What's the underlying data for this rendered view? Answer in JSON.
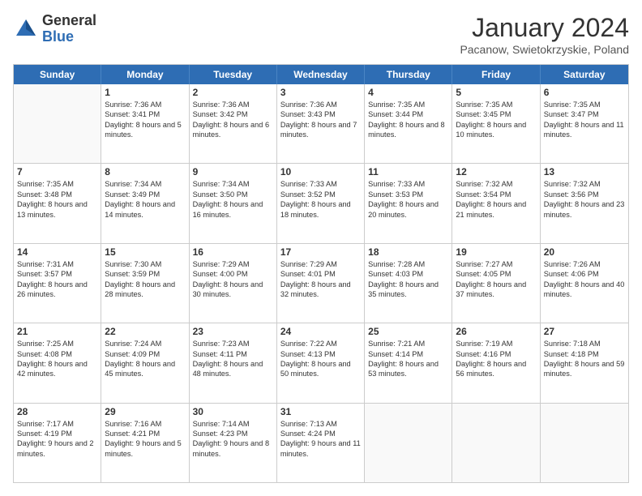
{
  "header": {
    "logo_general": "General",
    "logo_blue": "Blue",
    "month_title": "January 2024",
    "subtitle": "Pacanow, Swietokrzyskie, Poland"
  },
  "days_of_week": [
    "Sunday",
    "Monday",
    "Tuesday",
    "Wednesday",
    "Thursday",
    "Friday",
    "Saturday"
  ],
  "weeks": [
    [
      {
        "day": "",
        "sunrise": "",
        "sunset": "",
        "daylight": ""
      },
      {
        "day": "1",
        "sunrise": "Sunrise: 7:36 AM",
        "sunset": "Sunset: 3:41 PM",
        "daylight": "Daylight: 8 hours and 5 minutes."
      },
      {
        "day": "2",
        "sunrise": "Sunrise: 7:36 AM",
        "sunset": "Sunset: 3:42 PM",
        "daylight": "Daylight: 8 hours and 6 minutes."
      },
      {
        "day": "3",
        "sunrise": "Sunrise: 7:36 AM",
        "sunset": "Sunset: 3:43 PM",
        "daylight": "Daylight: 8 hours and 7 minutes."
      },
      {
        "day": "4",
        "sunrise": "Sunrise: 7:35 AM",
        "sunset": "Sunset: 3:44 PM",
        "daylight": "Daylight: 8 hours and 8 minutes."
      },
      {
        "day": "5",
        "sunrise": "Sunrise: 7:35 AM",
        "sunset": "Sunset: 3:45 PM",
        "daylight": "Daylight: 8 hours and 10 minutes."
      },
      {
        "day": "6",
        "sunrise": "Sunrise: 7:35 AM",
        "sunset": "Sunset: 3:47 PM",
        "daylight": "Daylight: 8 hours and 11 minutes."
      }
    ],
    [
      {
        "day": "7",
        "sunrise": "Sunrise: 7:35 AM",
        "sunset": "Sunset: 3:48 PM",
        "daylight": "Daylight: 8 hours and 13 minutes."
      },
      {
        "day": "8",
        "sunrise": "Sunrise: 7:34 AM",
        "sunset": "Sunset: 3:49 PM",
        "daylight": "Daylight: 8 hours and 14 minutes."
      },
      {
        "day": "9",
        "sunrise": "Sunrise: 7:34 AM",
        "sunset": "Sunset: 3:50 PM",
        "daylight": "Daylight: 8 hours and 16 minutes."
      },
      {
        "day": "10",
        "sunrise": "Sunrise: 7:33 AM",
        "sunset": "Sunset: 3:52 PM",
        "daylight": "Daylight: 8 hours and 18 minutes."
      },
      {
        "day": "11",
        "sunrise": "Sunrise: 7:33 AM",
        "sunset": "Sunset: 3:53 PM",
        "daylight": "Daylight: 8 hours and 20 minutes."
      },
      {
        "day": "12",
        "sunrise": "Sunrise: 7:32 AM",
        "sunset": "Sunset: 3:54 PM",
        "daylight": "Daylight: 8 hours and 21 minutes."
      },
      {
        "day": "13",
        "sunrise": "Sunrise: 7:32 AM",
        "sunset": "Sunset: 3:56 PM",
        "daylight": "Daylight: 8 hours and 23 minutes."
      }
    ],
    [
      {
        "day": "14",
        "sunrise": "Sunrise: 7:31 AM",
        "sunset": "Sunset: 3:57 PM",
        "daylight": "Daylight: 8 hours and 26 minutes."
      },
      {
        "day": "15",
        "sunrise": "Sunrise: 7:30 AM",
        "sunset": "Sunset: 3:59 PM",
        "daylight": "Daylight: 8 hours and 28 minutes."
      },
      {
        "day": "16",
        "sunrise": "Sunrise: 7:29 AM",
        "sunset": "Sunset: 4:00 PM",
        "daylight": "Daylight: 8 hours and 30 minutes."
      },
      {
        "day": "17",
        "sunrise": "Sunrise: 7:29 AM",
        "sunset": "Sunset: 4:01 PM",
        "daylight": "Daylight: 8 hours and 32 minutes."
      },
      {
        "day": "18",
        "sunrise": "Sunrise: 7:28 AM",
        "sunset": "Sunset: 4:03 PM",
        "daylight": "Daylight: 8 hours and 35 minutes."
      },
      {
        "day": "19",
        "sunrise": "Sunrise: 7:27 AM",
        "sunset": "Sunset: 4:05 PM",
        "daylight": "Daylight: 8 hours and 37 minutes."
      },
      {
        "day": "20",
        "sunrise": "Sunrise: 7:26 AM",
        "sunset": "Sunset: 4:06 PM",
        "daylight": "Daylight: 8 hours and 40 minutes."
      }
    ],
    [
      {
        "day": "21",
        "sunrise": "Sunrise: 7:25 AM",
        "sunset": "Sunset: 4:08 PM",
        "daylight": "Daylight: 8 hours and 42 minutes."
      },
      {
        "day": "22",
        "sunrise": "Sunrise: 7:24 AM",
        "sunset": "Sunset: 4:09 PM",
        "daylight": "Daylight: 8 hours and 45 minutes."
      },
      {
        "day": "23",
        "sunrise": "Sunrise: 7:23 AM",
        "sunset": "Sunset: 4:11 PM",
        "daylight": "Daylight: 8 hours and 48 minutes."
      },
      {
        "day": "24",
        "sunrise": "Sunrise: 7:22 AM",
        "sunset": "Sunset: 4:13 PM",
        "daylight": "Daylight: 8 hours and 50 minutes."
      },
      {
        "day": "25",
        "sunrise": "Sunrise: 7:21 AM",
        "sunset": "Sunset: 4:14 PM",
        "daylight": "Daylight: 8 hours and 53 minutes."
      },
      {
        "day": "26",
        "sunrise": "Sunrise: 7:19 AM",
        "sunset": "Sunset: 4:16 PM",
        "daylight": "Daylight: 8 hours and 56 minutes."
      },
      {
        "day": "27",
        "sunrise": "Sunrise: 7:18 AM",
        "sunset": "Sunset: 4:18 PM",
        "daylight": "Daylight: 8 hours and 59 minutes."
      }
    ],
    [
      {
        "day": "28",
        "sunrise": "Sunrise: 7:17 AM",
        "sunset": "Sunset: 4:19 PM",
        "daylight": "Daylight: 9 hours and 2 minutes."
      },
      {
        "day": "29",
        "sunrise": "Sunrise: 7:16 AM",
        "sunset": "Sunset: 4:21 PM",
        "daylight": "Daylight: 9 hours and 5 minutes."
      },
      {
        "day": "30",
        "sunrise": "Sunrise: 7:14 AM",
        "sunset": "Sunset: 4:23 PM",
        "daylight": "Daylight: 9 hours and 8 minutes."
      },
      {
        "day": "31",
        "sunrise": "Sunrise: 7:13 AM",
        "sunset": "Sunset: 4:24 PM",
        "daylight": "Daylight: 9 hours and 11 minutes."
      },
      {
        "day": "",
        "sunrise": "",
        "sunset": "",
        "daylight": ""
      },
      {
        "day": "",
        "sunrise": "",
        "sunset": "",
        "daylight": ""
      },
      {
        "day": "",
        "sunrise": "",
        "sunset": "",
        "daylight": ""
      }
    ]
  ]
}
